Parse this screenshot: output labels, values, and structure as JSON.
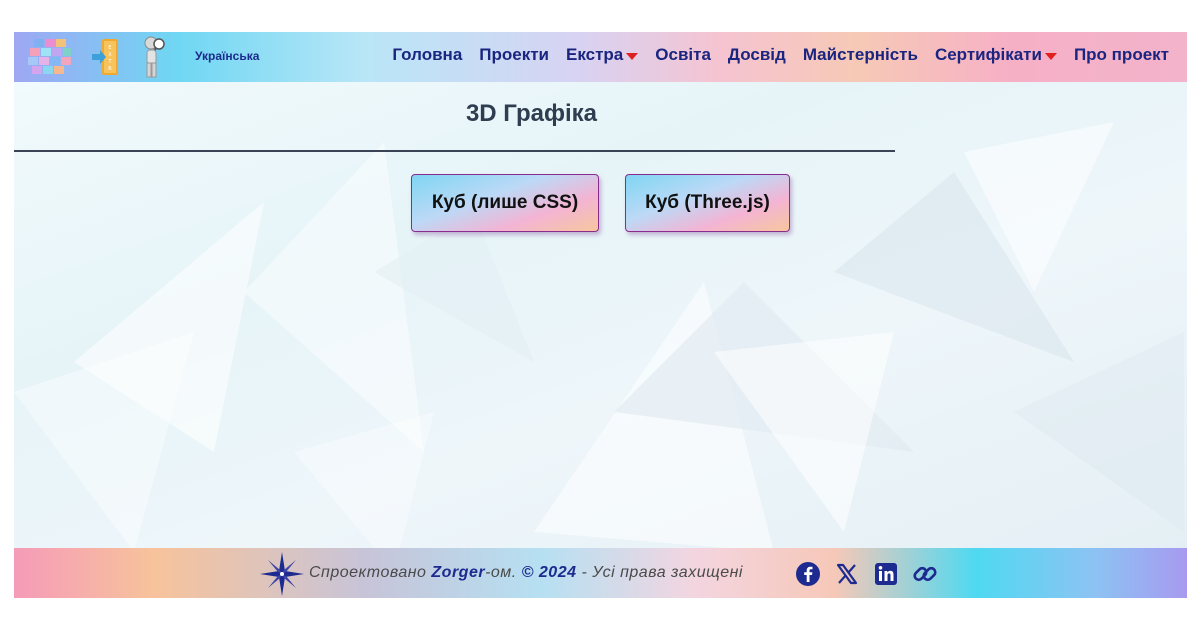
{
  "header": {
    "language": "Українська",
    "nav": [
      {
        "label": "Головна",
        "dropdown": false
      },
      {
        "label": "Проекти",
        "dropdown": false
      },
      {
        "label": "Екстра",
        "dropdown": true
      },
      {
        "label": "Освіта",
        "dropdown": false
      },
      {
        "label": "Досвід",
        "dropdown": false
      },
      {
        "label": "Майстерність",
        "dropdown": false
      },
      {
        "label": "Сертифікати",
        "dropdown": true
      },
      {
        "label": "Про проект",
        "dropdown": false
      }
    ]
  },
  "main": {
    "title": "3D Графіка",
    "buttons": [
      {
        "label": "Куб (лише CSS)"
      },
      {
        "label": "Куб (Three.js)"
      }
    ]
  },
  "footer": {
    "designed": "Спроектовано",
    "author": "Zorger",
    "suffix": "-ом.",
    "copyright": "© 2024",
    "rights": "- Усі права захищені",
    "social_icons": [
      "facebook-icon",
      "x-icon",
      "linkedin-icon",
      "link-icon"
    ]
  },
  "colors": {
    "nav_text": "#1a2580",
    "caret": "#e0201f",
    "title_text": "#2e3d4f",
    "button_border": "#8a2c8e"
  }
}
